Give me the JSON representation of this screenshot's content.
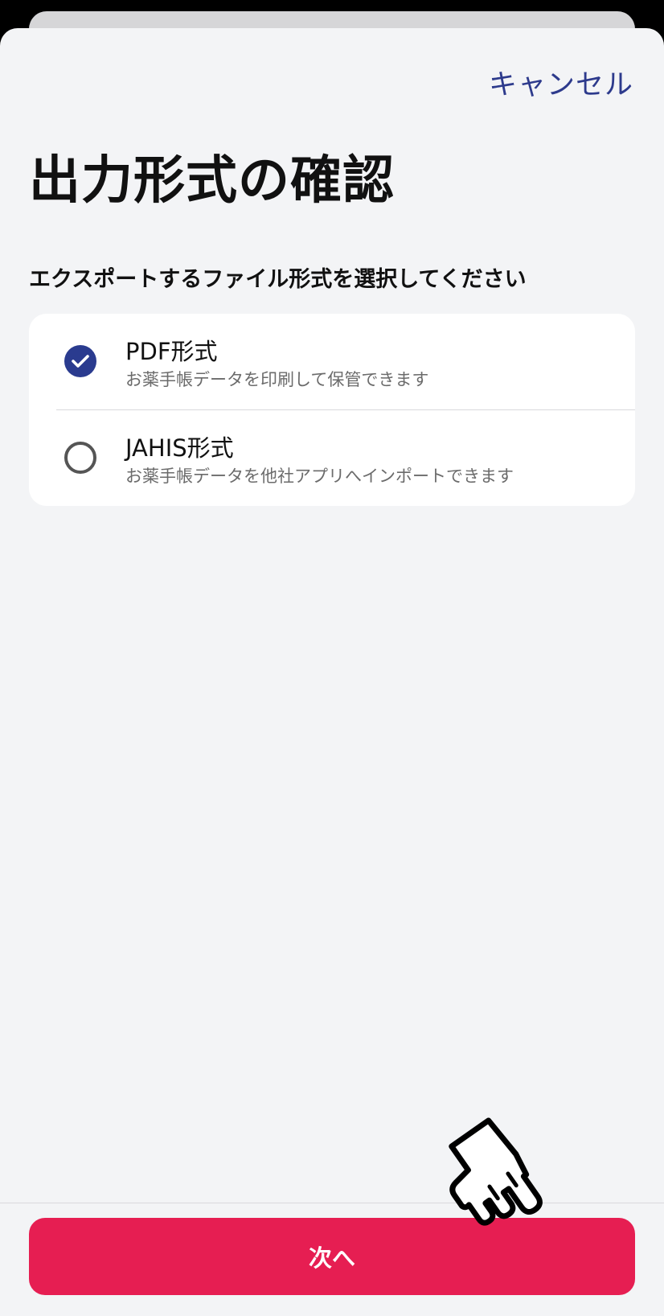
{
  "header": {
    "cancel_label": "キャンセル",
    "title": "出力形式の確認"
  },
  "main": {
    "subtitle": "エクスポートするファイル形式を選択してください",
    "options": [
      {
        "label": "PDF形式",
        "description": "お薬手帳データを印刷して保管できます",
        "selected": true
      },
      {
        "label": "JAHIS形式",
        "description": "お薬手帳データを他社アプリへインポートできます",
        "selected": false
      }
    ]
  },
  "footer": {
    "next_label": "次へ"
  },
  "colors": {
    "accent": "#2a3b8f",
    "primary_button": "#e61e52",
    "background": "#f3f4f6"
  },
  "icons": {
    "selected_indicator": "check-circle-icon",
    "unselected_indicator": "radio-empty-icon",
    "pointer_overlay": "pointing-hand-icon"
  }
}
